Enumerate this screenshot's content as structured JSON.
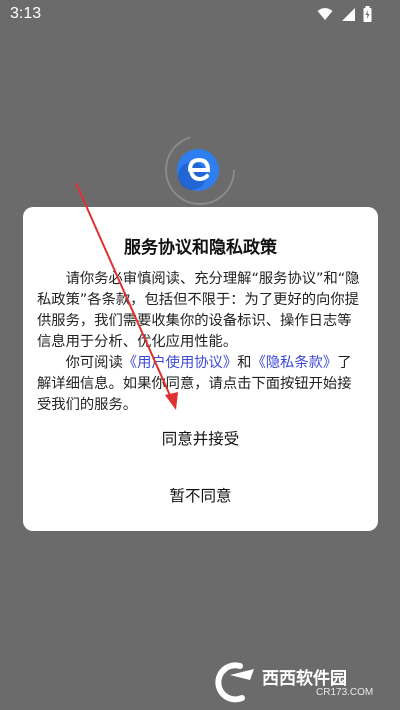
{
  "status_bar": {
    "time": "3:13",
    "icons": [
      "wifi-icon",
      "signal-icon",
      "battery-icon"
    ]
  },
  "dialog": {
    "title": "服务协议和隐私政策",
    "para1": "请你务必审慎阅读、充分理解“服务协议”和“隐私政策”各条款，包括但不限于：为了更好的向你提供服务，我们需要收集你的设备标识、操作日志等信息用于分析、优化应用性能。",
    "para2_prefix": "你可阅读",
    "user_agreement_link": "《用户使用协议》",
    "para2_and": "和",
    "privacy_link": "《隐私条款》",
    "para2_suffix": "了解详细信息。如果你同意，请点击下面按钮开始接受我们的服务。",
    "agree_label": "同意并接受",
    "decline_label": "暂不同意"
  },
  "watermark": {
    "name": "西西软件园",
    "url": "CR173.COM"
  },
  "colors": {
    "overlay": "#6b6b6b",
    "link": "#3b49d8",
    "arrow": "#e03030",
    "logo": "#2f7ef0"
  }
}
